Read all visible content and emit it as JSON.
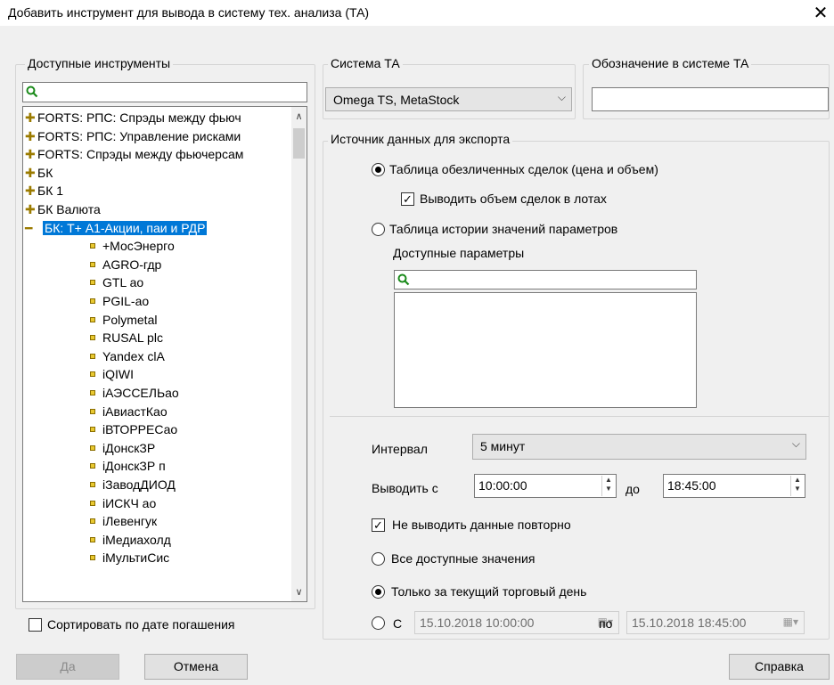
{
  "window": {
    "title": "Добавить инструмент для вывода в систему тех. анализа (ТА)",
    "close_label": "✕"
  },
  "instruments": {
    "legend": "Доступные инструменты",
    "search_placeholder": "",
    "groups": [
      "FORTS: РПС: Спрэды между фьюч",
      "FORTS: РПС: Управление рисками",
      "FORTS: Спрэды между фьючерсам",
      "БК",
      "БК 1",
      "БК Валюта"
    ],
    "selected_group": "БК: Т+ А1-Акции, паи и РДР",
    "items": [
      "+МосЭнерго",
      "AGRO-гдр",
      "GTL ао",
      "PGIL-ао",
      "Polymetal",
      "RUSAL plc",
      "Yandex clA",
      "iQIWI",
      "iАЭССЕЛЬао",
      "iАвиастКао",
      "iВТОРРЕСао",
      "iДонскЗР",
      "iДонскЗР п",
      "iЗаводДИОД",
      "iИСКЧ ао",
      "iЛевенгук",
      "iМедиахолд",
      "iМультиСис"
    ],
    "sort_label": "Сортировать по дате погашения"
  },
  "ta_system": {
    "legend": "Система ТА",
    "value": "Omega TS, MetaStock"
  },
  "ta_designation": {
    "legend": "Обозначение в системе ТА",
    "value": ""
  },
  "source": {
    "legend": "Источник данных для экспорта",
    "opt_trades": "Таблица обезличенных сделок (цена и объем)",
    "opt_lots": "Выводить объем  сделок в лотах",
    "opt_history": "Таблица истории значений параметров",
    "params_label": "Доступные параметры"
  },
  "settings": {
    "interval_label": "Интервал",
    "interval_value": "5 минут",
    "from_label": "Выводить с",
    "from_time": "10:00:00",
    "to_label": "до",
    "to_time": "18:45:00",
    "no_repeat": "Не выводить данные повторно",
    "all_values": "Все доступные значения",
    "today_only": "Только за текущий торговый день",
    "from_date_label": "С",
    "from_date": "15.10.2018 10:00:00",
    "to_date_label": "по",
    "to_date": "15.10.2018 18:45:00"
  },
  "buttons": {
    "ok": "Да",
    "cancel": "Отмена",
    "help": "Справка"
  }
}
